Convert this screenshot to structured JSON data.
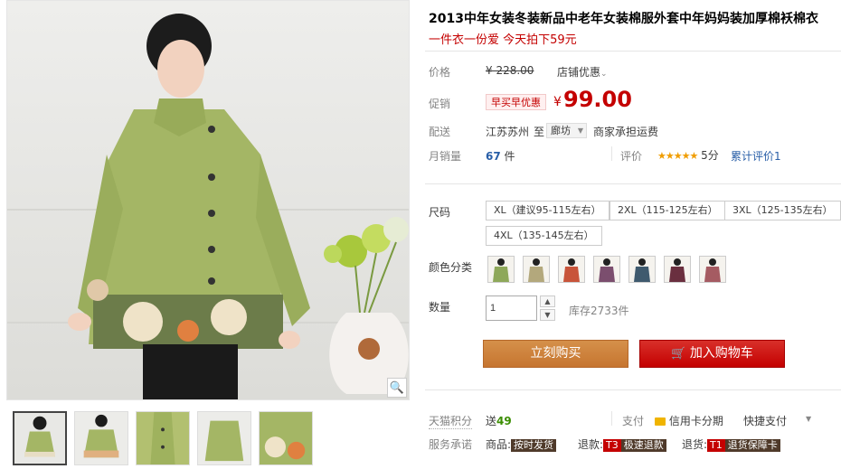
{
  "product": {
    "title": "2013中年女装冬装新品中老年女装棉服外套中年妈妈装加厚棉袄棉衣",
    "subtitle": "一件衣一份爱 今天拍下59元"
  },
  "price": {
    "label": "价格",
    "original": "¥ 228.00",
    "shop_discount": "店铺优惠",
    "promo_label": "促销",
    "promo_badge": "早买早优惠",
    "currency": "¥",
    "value": "99.00"
  },
  "shipping": {
    "label": "配送",
    "from": "江苏苏州",
    "to_word": "至",
    "destination": "廊坊",
    "fee_note": "商家承担运费"
  },
  "sales": {
    "label": "月销量",
    "count": "67",
    "unit": "件",
    "review_label": "评价",
    "stars": "★★★★★",
    "score": "5分",
    "total_reviews": "累计评价1"
  },
  "size": {
    "label": "尺码",
    "options": [
      "XL（建议95-115左右）",
      "2XL（115-125左右）",
      "3XL（125-135左右）",
      "4XL（135-145左右）"
    ]
  },
  "color": {
    "label": "颜色分类",
    "swatches": [
      "#8ea85a",
      "#b3a87c",
      "#c8543a",
      "#7b4e6e",
      "#3f5a6e",
      "#6a2f3f",
      "#a55b62"
    ]
  },
  "quantity": {
    "label": "数量",
    "value": "1",
    "stock": "库存2733件"
  },
  "buttons": {
    "buy_now": "立刻购买",
    "add_cart": "加入购物车"
  },
  "footer": {
    "points_label": "天猫积分",
    "points_prefix": "送",
    "points_value": "49",
    "pay_label": "支付",
    "credit_installment": "信用卡分期",
    "quick_pay": "快捷支付",
    "service_label": "服务承诺",
    "goods_label": "商品:",
    "goods_badge": "按时发货",
    "refund_label": "退款:",
    "refund_tag": "T3",
    "refund_badge": "极速退款",
    "return_label": "退货:",
    "return_tag": "T1",
    "return_badge": "退货保障卡"
  }
}
